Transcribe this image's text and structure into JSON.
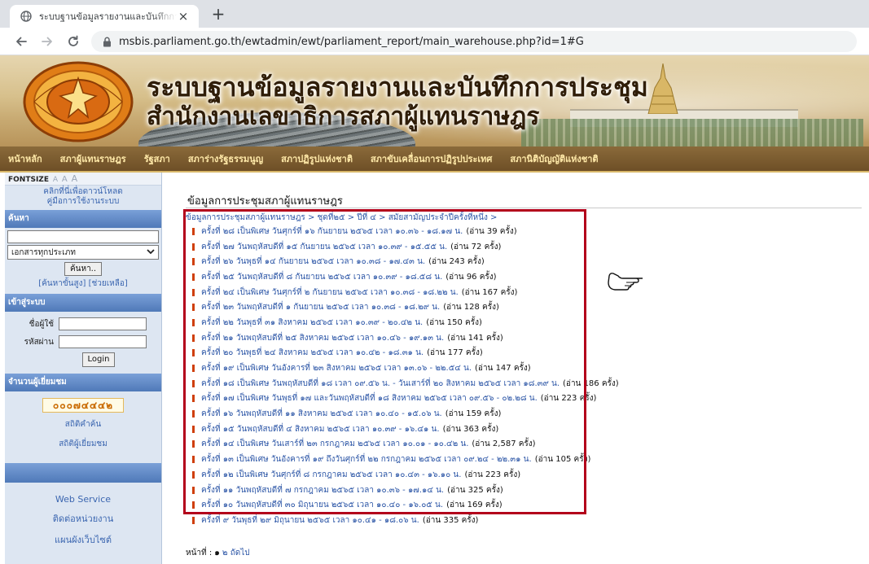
{
  "browser": {
    "tab_title": "ระบบฐานข้อมูลรายงานและบันทึกการประชุม",
    "url": "msbis.parliament.go.th/ewtadmin/ewt/parliament_report/main_warehouse.php?id=1#G",
    "close_glyph": "×",
    "newtab_glyph": "+"
  },
  "banner": {
    "title_line1": "ระบบฐานข้อมูลรายงานและบันทึกการประชุม",
    "title_line2": "สำนักงานเลขาธิการสภาผู้แทนราษฎร"
  },
  "nav": {
    "items": [
      "หน้าหลัก",
      "สภาผู้แทนราษฎร",
      "รัฐสภา",
      "สภาร่างรัฐธรรมนูญ",
      "สภาปฏิรูปแห่งชาติ",
      "สภาขับเคลื่อนการปฏิรูปประเทศ",
      "สภานิติบัญญัติแห่งชาติ"
    ]
  },
  "sidebar": {
    "fontsize_label": "FONTSIZE",
    "fontsize_a1": "A",
    "fontsize_a2": "A",
    "fontsize_a3": "A",
    "download_link": "คลิกที่นี่เพื่อดาวน์โหลด",
    "manual_link": "คู่มือการใช้งานระบบ",
    "search_head": "ค้นหา",
    "doctype_value": "เอกสารทุกประเภท",
    "search_button": "ค้นหา..",
    "advanced_link": "[ค้นหาขั้นสูง] [ช่วยเหลือ]",
    "login_head": "เข้าสู่ระบบ",
    "username_label": "ชื่อผู้ใช้",
    "password_label": "รหัสผ่าน",
    "login_button": "Login",
    "visitors_head": "จำนวนผู้เยี่ยมชม",
    "visitor_count": "๐๐๐๗๔๔๔๒",
    "search_stats": "สถิติคำค้น",
    "visitor_stats": "สถิติผู้เยี่ยมชม",
    "web_service": "Web Service",
    "contact": "ติดต่อหน่วยงาน",
    "sitemap": "แผนผังเว็บไซต์"
  },
  "main": {
    "title": "ข้อมูลการประชุมสภาผู้แทนราษฎร",
    "breadcrumb": "ข้อมูลการประชุมสภาผู้แทนราษฎร > ชุดที่๒๕ > ปีที่ ๔ > สมัยสามัญประจำปีครั้งที่หนึ่ง >",
    "items": [
      {
        "text": "ครั้งที่ ๒๘ เป็นพิเศษ วันศุกร์ที่ ๑๖ กันยายน ๒๕๖๕ เวลา ๑๐.๓๖ - ๑๘.๑๗ น.",
        "count": "(อ่าน 39 ครั้ง)"
      },
      {
        "text": "ครั้งที่ ๒๗ วันพฤหัสบดีที่ ๑๕ กันยายน ๒๕๖๕ เวลา ๑๐.๓๙ - ๑๕.๕๕ น.",
        "count": "(อ่าน 72 ครั้ง)"
      },
      {
        "text": "ครั้งที่ ๒๖ วันพุธที่ ๑๔ กันยายน ๒๕๖๕ เวลา ๑๐.๓๘ - ๑๗.๔๓ น.",
        "count": "(อ่าน 243 ครั้ง)"
      },
      {
        "text": "ครั้งที่ ๒๕ วันพฤหัสบดีที่ ๘ กันยายน ๒๕๖๕ เวลา ๑๐.๓๙ - ๑๘.๕๘ น.",
        "count": "(อ่าน 96 ครั้ง)"
      },
      {
        "text": "ครั้งที่ ๒๔ เป็นพิเศษ วันศุกร์ที่ ๒ กันยายน ๒๕๖๕ เวลา ๑๐.๓๘ - ๑๘.๒๒ น.",
        "count": "(อ่าน 167 ครั้ง)"
      },
      {
        "text": "ครั้งที่ ๒๓ วันพฤหัสบดีที่ ๑ กันยายน ๒๕๖๕ เวลา ๑๐.๓๘ - ๑๘.๒๙ น.",
        "count": "(อ่าน 128 ครั้ง)"
      },
      {
        "text": "ครั้งที่ ๒๒ วันพุธที่ ๓๑ สิงหาคม ๒๕๖๕ เวลา ๑๐.๓๙ - ๒๐.๔๒ น.",
        "count": "(อ่าน 150 ครั้ง)"
      },
      {
        "text": "ครั้งที่ ๒๑ วันพฤหัสบดีที่ ๒๕ สิงหาคม ๒๕๖๕ เวลา ๑๐.๔๖ - ๑๙.๑๓ น.",
        "count": "(อ่าน 141 ครั้ง)"
      },
      {
        "text": "ครั้งที่ ๒๐ วันพุธที่ ๒๔ สิงหาคม ๒๕๖๕ เวลา ๑๐.๔๒ - ๑๘.๓๑ น.",
        "count": "(อ่าน 177 ครั้ง)"
      },
      {
        "text": "ครั้งที่ ๑๙ เป็นพิเศษ วันอังคารที่ ๒๓ สิงหาคม ๒๕๖๕ เวลา ๑๓.๐๖ - ๒๒.๕๔ น.",
        "count": "(อ่าน 147 ครั้ง)"
      },
      {
        "text": "ครั้งที่ ๑๘ เป็นพิเศษ วันพฤหัสบดีที่ ๑๘ เวลา ๐๙.๕๖ น. - วันเสาร์ที่ ๒๐ สิงหาคม ๒๕๖๕ เวลา ๑๘.๓๙ น.",
        "count": "(อ่าน 186 ครั้ง)"
      },
      {
        "text": "ครั้งที่ ๑๗ เป็นพิเศษ วันพุธที่ ๑๗ และวันพฤหัสบดีที่ ๑๘ สิงหาคม ๒๕๖๕ เวลา ๐๙.๕๖ - ๐๒.๒๘ น.",
        "count": "(อ่าน 223 ครั้ง)"
      },
      {
        "text": "ครั้งที่ ๑๖ วันพฤหัสบดีที่ ๑๑ สิงหาคม ๒๕๖๕ เวลา ๑๐.๔๐ - ๑๕.๐๖ น.",
        "count": "(อ่าน 159 ครั้ง)"
      },
      {
        "text": "ครั้งที่ ๑๕ วันพฤหัสบดีที่ ๔ สิงหาคม ๒๕๖๕ เวลา ๑๐.๓๙ - ๑๖.๔๑ น.",
        "count": "(อ่าน 363 ครั้ง)"
      },
      {
        "text": "ครั้งที่ ๑๔ เป็นพิเศษ วันเสาร์ที่ ๒๓ กรกฎาคม ๒๕๖๕ เวลา ๑๐.๐๑ - ๑๐.๔๒ น.",
        "count": "(อ่าน 2,587 ครั้ง)"
      },
      {
        "text": "ครั้งที่ ๑๓ เป็นพิเศษ วันอังคารที่ ๑๙ ถึงวันศุกร์ที่ ๒๒ กรกฎาคม ๒๕๖๕ เวลา ๐๙.๒๔ - ๒๒.๓๑ น.",
        "count": "(อ่าน 105 ครั้ง)"
      },
      {
        "text": "ครั้งที่ ๑๒ เป็นพิเศษ วันศุกร์ที่ ๘ กรกฎาคม ๒๕๖๕ เวลา ๑๐.๔๓ - ๑๖.๑๐ น.",
        "count": "(อ่าน 223 ครั้ง)"
      },
      {
        "text": "ครั้งที่ ๑๑ วันพฤหัสบดีที่ ๗ กรกฎาคม ๒๕๖๕ เวลา ๑๐.๓๖ - ๑๗.๑๔ น.",
        "count": "(อ่าน 325 ครั้ง)"
      },
      {
        "text": "ครั้งที่ ๑๐ วันพฤหัสบดีที่ ๓๐ มิถุนายน ๒๕๖๕ เวลา ๑๐.๔๐ - ๑๖.๐๕ น.",
        "count": "(อ่าน 169 ครั้ง)"
      },
      {
        "text": "ครั้งที่ ๙ วันพุธที่ ๒๙ มิถุนายน ๒๕๖๕ เวลา ๑๐.๔๑ - ๑๘.๐๖ น.",
        "count": "(อ่าน 335 ครั้ง)"
      }
    ],
    "pager_label": "หน้าที่ :",
    "pager_current": "๑",
    "pager_page2": "๒",
    "pager_next": "ถัดไป"
  }
}
